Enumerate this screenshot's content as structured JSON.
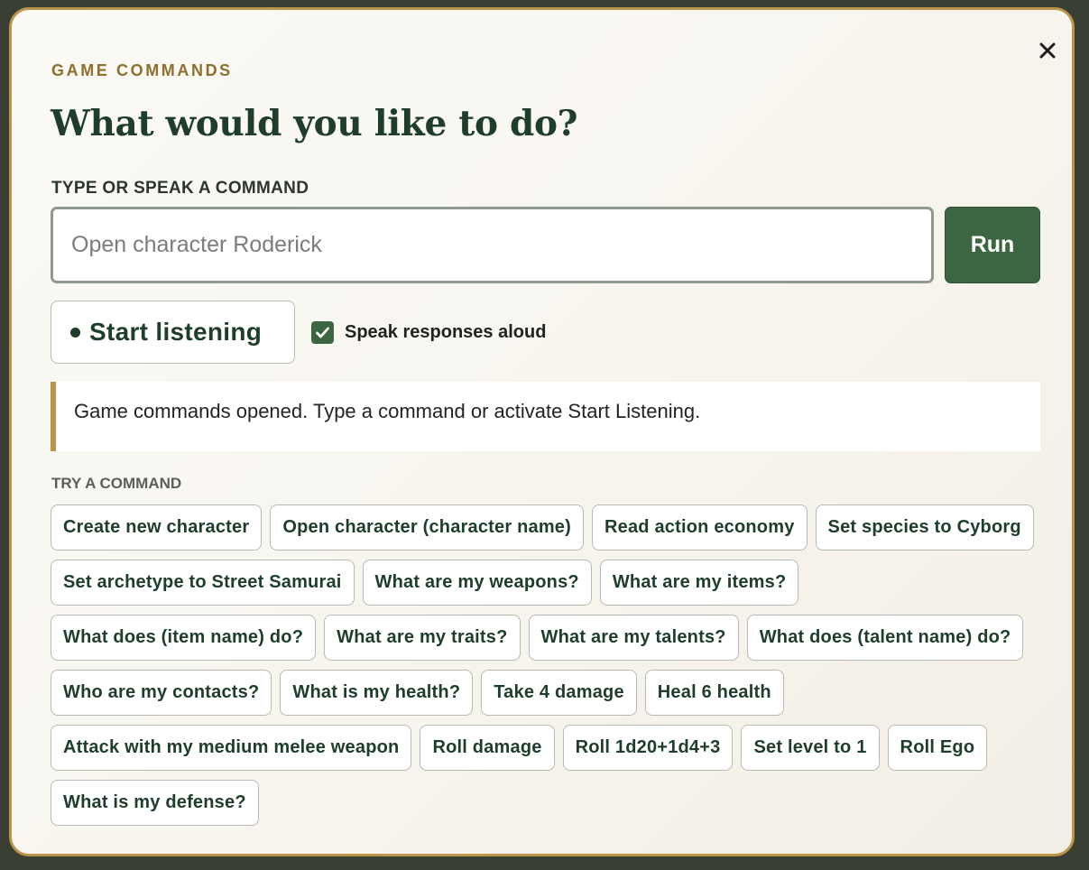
{
  "dialog": {
    "eyebrow": "GAME COMMANDS",
    "title": "What would you like to do?",
    "close_icon": "close-icon"
  },
  "command": {
    "label": "TYPE OR SPEAK A COMMAND",
    "placeholder": "Open character Roderick",
    "value": "",
    "run_label": "Run"
  },
  "voice": {
    "listen_label": "Start listening",
    "speak_aloud_label": "Speak responses aloud",
    "speak_aloud_checked": true
  },
  "status": {
    "message": "Game commands opened. Type a command or activate Start Listening."
  },
  "suggestions": {
    "label": "TRY A COMMAND",
    "items": [
      "Create new character",
      "Open character (character name)",
      "Read action economy",
      "Set species to Cyborg",
      "Set archetype to Street Samurai",
      "What are my weapons?",
      "What are my items?",
      "What does (item name) do?",
      "What are my traits?",
      "What are my talents?",
      "What does (talent name) do?",
      "Who are my contacts?",
      "What is my health?",
      "Take 4 damage",
      "Heal 6 health",
      "Attack with my medium melee weapon",
      "Roll damage",
      "Roll 1d20+1d4+3",
      "Set level to 1",
      "Roll Ego",
      "What is my defense?"
    ]
  },
  "colors": {
    "accent_gold": "#b8954a",
    "primary_green": "#3b6641",
    "title_green": "#1f3d2b"
  }
}
